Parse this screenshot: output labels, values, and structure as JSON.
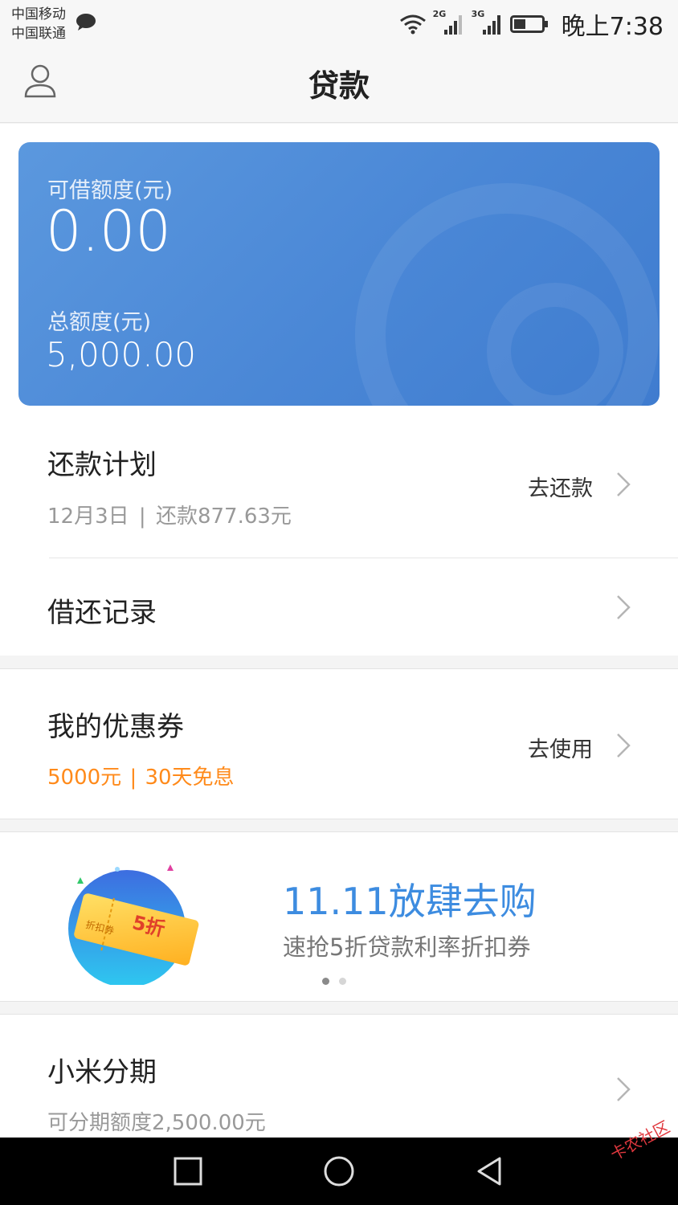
{
  "status_bar": {
    "carrier1": "中国移动",
    "carrier2": "中国联通",
    "net1": "2G",
    "net2": "3G",
    "time": "晚上7:38"
  },
  "header": {
    "title": "贷款"
  },
  "credit_card": {
    "available_label": "可借额度(元)",
    "available_value": "0.00",
    "total_label": "总额度(元)",
    "total_value": "5,000.00"
  },
  "repayment": {
    "title": "还款计划",
    "date": "12月3日",
    "separator": "|",
    "amount": "还款877.63元",
    "action": "去还款"
  },
  "records": {
    "title": "借还记录"
  },
  "coupons": {
    "title": "我的优惠券",
    "amount": "5000元",
    "separator": "|",
    "term": "30天免息",
    "action": "去使用"
  },
  "promo": {
    "title": "11.11放肆去购",
    "subtitle": "速抢5折贷款利率折扣券",
    "ticket_text": "5折",
    "ticket_stamp": "折扣券",
    "active_page": 1,
    "page_count": 2
  },
  "installment": {
    "title": "小米分期",
    "subtitle": "可分期额度2,500.00元"
  },
  "watermark": "卡农社区",
  "colors": {
    "card_blue": "#4a87d6",
    "promo_blue": "#3d8ce0",
    "orange": "#ff8a1a"
  }
}
